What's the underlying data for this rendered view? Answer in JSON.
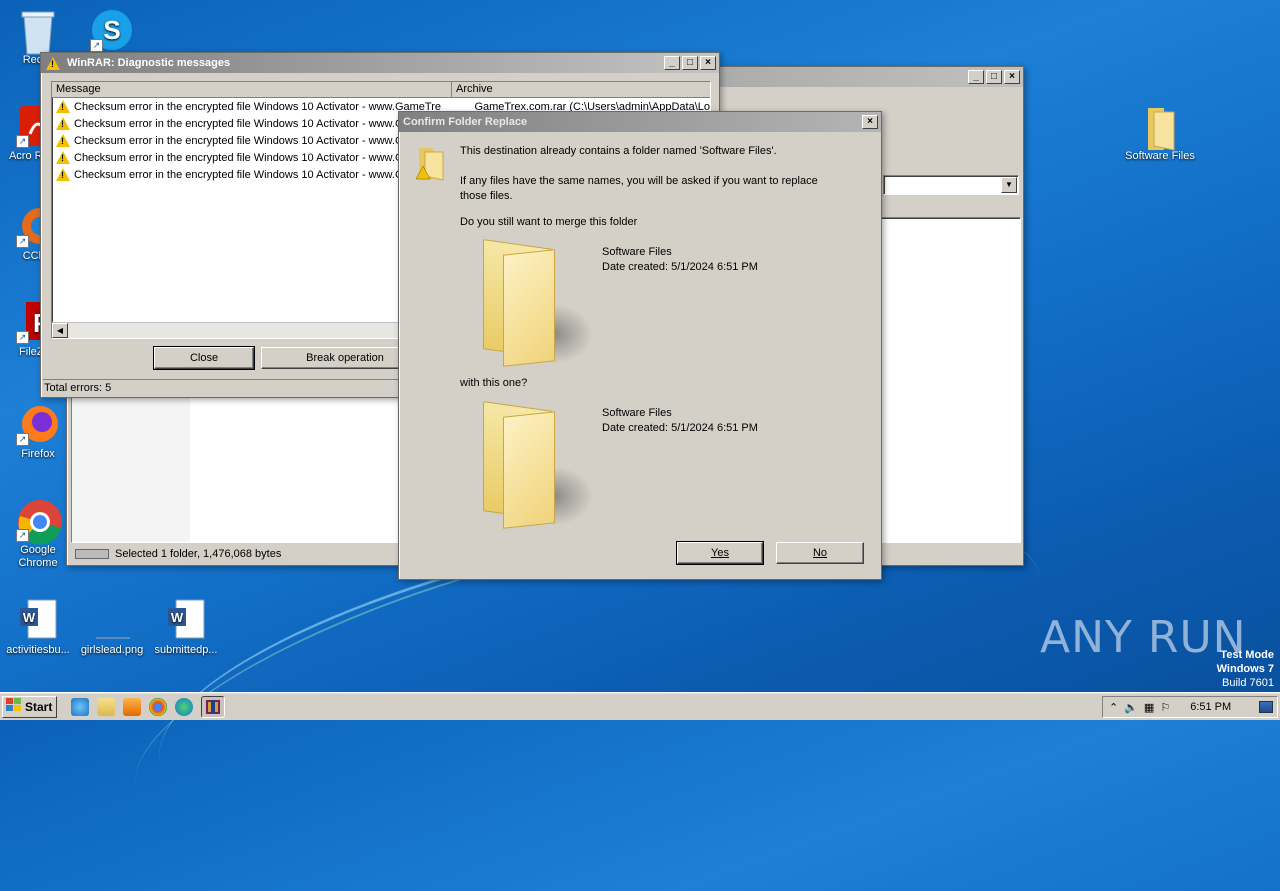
{
  "desktop": {
    "icons": [
      {
        "label": "Recyc",
        "icon": "recycle-bin-icon"
      },
      {
        "label": "",
        "icon": "skype-icon"
      },
      {
        "label": "Acro Reade",
        "icon": "acrobat-reader-icon"
      },
      {
        "label": "CClea",
        "icon": "ccleaner-icon"
      },
      {
        "label": "FileZilla",
        "icon": "filezilla-icon"
      },
      {
        "label": "Firefox",
        "icon": "firefox-icon"
      },
      {
        "label": "Google Chrome",
        "icon": "chrome-icon"
      },
      {
        "label": "activitiesbu...",
        "icon": "word-document-icon"
      },
      {
        "label": "girlslead.png",
        "icon": "image-file-icon"
      },
      {
        "label": "submittedp...",
        "icon": "word-document-icon"
      },
      {
        "label": "Software Files",
        "icon": "folder-icon"
      }
    ],
    "watermark": {
      "brand": "ANY RUN",
      "mode_line1": "Test Mode",
      "mode_line2": "Windows 7",
      "mode_line3": "Build 7601"
    }
  },
  "diagnostic_window": {
    "title": "WinRAR: Diagnostic messages",
    "columns": [
      "Message",
      "Archive"
    ],
    "rows": [
      {
        "message": "Checksum error in the encrypted file Windows 10 Activator - www.GameTre",
        "archive": "GameTrex.com.rar (C:\\Users\\admin\\AppData\\Lo"
      },
      {
        "message": "Checksum error in the encrypted file Windows 10 Activator - www.G",
        "archive": ""
      },
      {
        "message": "Checksum error in the encrypted file Windows 10 Activator - www.G",
        "archive": ""
      },
      {
        "message": "Checksum error in the encrypted file Windows 10 Activator - www.G",
        "archive": ""
      },
      {
        "message": "Checksum error in the encrypted file Windows 10 Activator - www.G",
        "archive": ""
      }
    ],
    "close_label": "Close",
    "break_label": "Break operation",
    "status": "Total errors: 5"
  },
  "background_window": {
    "status": "Selected 1 folder, 1,476,068 bytes"
  },
  "confirm_dialog": {
    "title": "Confirm Folder Replace",
    "line1": "This destination already contains a folder named 'Software Files'.",
    "line2a": "If any files have the same names, you will be asked if you want to replace",
    "line2b": "those files.",
    "line3": "Do you still want to merge this folder",
    "existing": {
      "name": "Software Files",
      "date": "Date created: 5/1/2024 6:51 PM"
    },
    "with_label": "with this one?",
    "incoming": {
      "name": "Software Files",
      "date": "Date created: 5/1/2024 6:51 PM"
    },
    "yes_label": "Yes",
    "no_label": "No"
  },
  "taskbar": {
    "start_label": "Start",
    "clock": "6:51 PM"
  }
}
